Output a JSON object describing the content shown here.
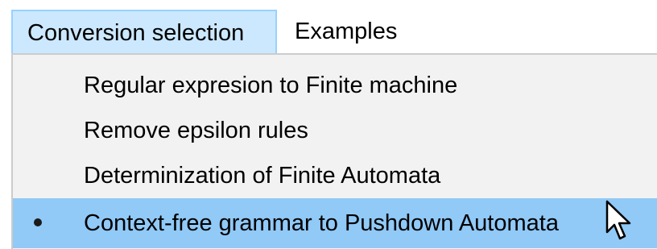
{
  "menubar": {
    "items": [
      {
        "label": "Conversion selection",
        "state": "open"
      },
      {
        "label": "Examples",
        "state": "closed"
      }
    ]
  },
  "dropdown": {
    "items": [
      {
        "label": "Regular expresion to Finite machine",
        "checked": false
      },
      {
        "label": "Remove epsilon rules",
        "checked": false
      },
      {
        "label": "Determinization of Finite Automata",
        "checked": false
      },
      {
        "label": "Context-free grammar to Pushdown Automata",
        "checked": true,
        "highlighted": true
      }
    ]
  },
  "icons": {
    "radio_check": "radio-bullet-icon",
    "cursor": "mouse-pointer-icon"
  },
  "colors": {
    "menu_open_bg": "#cce8ff",
    "menu_open_border": "#99d1ff",
    "dropdown_bg": "#f2f2f2",
    "highlight_bg": "#91c9f7"
  }
}
